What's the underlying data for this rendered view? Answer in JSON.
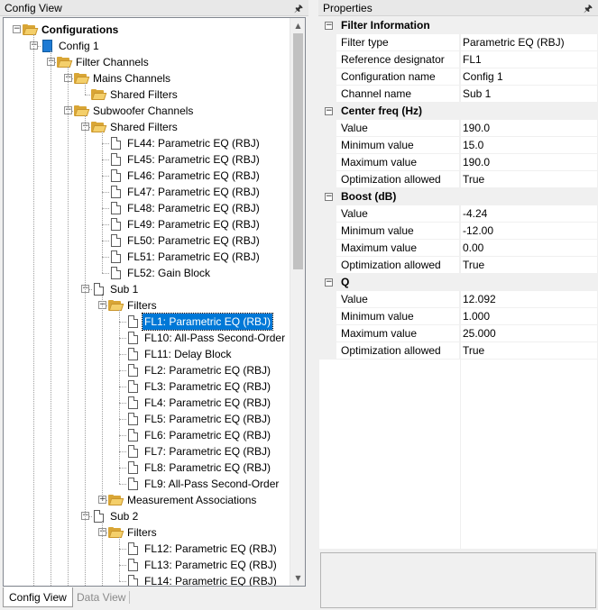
{
  "config_view": {
    "title": "Config View",
    "pin_icon": "pin-icon",
    "tree": [
      {
        "label": "Configurations",
        "icon": "folder-icon",
        "level": 0,
        "expander": "−",
        "bold": true
      },
      {
        "label": "Config 1",
        "icon": "config-icon",
        "level": 1,
        "expander": "−"
      },
      {
        "label": "Filter Channels",
        "icon": "folder-icon",
        "level": 2,
        "expander": "−"
      },
      {
        "label": "Mains Channels",
        "icon": "folder-icon",
        "level": 3,
        "expander": "−"
      },
      {
        "label": "Shared Filters",
        "icon": "folder-icon",
        "level": 4,
        "expander": ""
      },
      {
        "label": "Subwoofer Channels",
        "icon": "folder-icon",
        "level": 3,
        "expander": "−"
      },
      {
        "label": "Shared Filters",
        "icon": "folder-icon",
        "level": 4,
        "expander": "−"
      },
      {
        "label": "FL44: Parametric EQ (RBJ)",
        "icon": "document-icon",
        "level": 5,
        "expander": ""
      },
      {
        "label": "FL45: Parametric EQ (RBJ)",
        "icon": "document-icon",
        "level": 5,
        "expander": ""
      },
      {
        "label": "FL46: Parametric EQ (RBJ)",
        "icon": "document-icon",
        "level": 5,
        "expander": ""
      },
      {
        "label": "FL47: Parametric EQ (RBJ)",
        "icon": "document-icon",
        "level": 5,
        "expander": ""
      },
      {
        "label": "FL48: Parametric EQ (RBJ)",
        "icon": "document-icon",
        "level": 5,
        "expander": ""
      },
      {
        "label": "FL49: Parametric EQ (RBJ)",
        "icon": "document-icon",
        "level": 5,
        "expander": ""
      },
      {
        "label": "FL50: Parametric EQ (RBJ)",
        "icon": "document-icon",
        "level": 5,
        "expander": ""
      },
      {
        "label": "FL51: Parametric EQ (RBJ)",
        "icon": "document-icon",
        "level": 5,
        "expander": ""
      },
      {
        "label": "FL52: Gain Block",
        "icon": "document-icon",
        "level": 5,
        "expander": ""
      },
      {
        "label": "Sub 1",
        "icon": "document-icon",
        "level": 4,
        "expander": "−"
      },
      {
        "label": "Filters",
        "icon": "folder-icon",
        "level": 5,
        "expander": "−"
      },
      {
        "label": "FL1: Parametric EQ (RBJ)",
        "icon": "document-icon",
        "level": 6,
        "expander": "",
        "selected": true
      },
      {
        "label": "FL10: All-Pass Second-Order",
        "icon": "document-icon",
        "level": 6,
        "expander": ""
      },
      {
        "label": "FL11: Delay Block",
        "icon": "document-icon",
        "level": 6,
        "expander": ""
      },
      {
        "label": "FL2: Parametric EQ (RBJ)",
        "icon": "document-icon",
        "level": 6,
        "expander": ""
      },
      {
        "label": "FL3: Parametric EQ (RBJ)",
        "icon": "document-icon",
        "level": 6,
        "expander": ""
      },
      {
        "label": "FL4: Parametric EQ (RBJ)",
        "icon": "document-icon",
        "level": 6,
        "expander": ""
      },
      {
        "label": "FL5: Parametric EQ (RBJ)",
        "icon": "document-icon",
        "level": 6,
        "expander": ""
      },
      {
        "label": "FL6: Parametric EQ (RBJ)",
        "icon": "document-icon",
        "level": 6,
        "expander": ""
      },
      {
        "label": "FL7: Parametric EQ (RBJ)",
        "icon": "document-icon",
        "level": 6,
        "expander": ""
      },
      {
        "label": "FL8: Parametric EQ (RBJ)",
        "icon": "document-icon",
        "level": 6,
        "expander": ""
      },
      {
        "label": "FL9: All-Pass Second-Order",
        "icon": "document-icon",
        "level": 6,
        "expander": ""
      },
      {
        "label": "Measurement Associations",
        "icon": "folder-icon",
        "level": 5,
        "expander": "+"
      },
      {
        "label": "Sub 2",
        "icon": "document-icon",
        "level": 4,
        "expander": "−"
      },
      {
        "label": "Filters",
        "icon": "folder-icon",
        "level": 5,
        "expander": "−"
      },
      {
        "label": "FL12: Parametric EQ (RBJ)",
        "icon": "document-icon",
        "level": 6,
        "expander": ""
      },
      {
        "label": "FL13: Parametric EQ (RBJ)",
        "icon": "document-icon",
        "level": 6,
        "expander": ""
      },
      {
        "label": "FL14: Parametric EQ (RBJ)",
        "icon": "document-icon",
        "level": 6,
        "expander": ""
      }
    ],
    "tabs": [
      {
        "label": "Config View",
        "active": true
      },
      {
        "label": "Data View",
        "active": false
      }
    ]
  },
  "properties": {
    "title": "Properties",
    "categories": [
      {
        "name": "Filter Information",
        "rows": [
          {
            "name": "Filter type",
            "value": "Parametric EQ (RBJ)"
          },
          {
            "name": "Reference designator",
            "value": "FL1"
          },
          {
            "name": "Configuration name",
            "value": "Config 1"
          },
          {
            "name": "Channel name",
            "value": "Sub 1"
          }
        ]
      },
      {
        "name": "Center freq (Hz)",
        "rows": [
          {
            "name": "Value",
            "value": "190.0"
          },
          {
            "name": "Minimum value",
            "value": "15.0"
          },
          {
            "name": "Maximum value",
            "value": "190.0"
          },
          {
            "name": "Optimization allowed",
            "value": "True"
          }
        ]
      },
      {
        "name": "Boost (dB)",
        "rows": [
          {
            "name": "Value",
            "value": "-4.24"
          },
          {
            "name": "Minimum value",
            "value": "-12.00"
          },
          {
            "name": "Maximum value",
            "value": "0.00"
          },
          {
            "name": "Optimization allowed",
            "value": "True"
          }
        ]
      },
      {
        "name": "Q",
        "rows": [
          {
            "name": "Value",
            "value": "12.092"
          },
          {
            "name": "Minimum value",
            "value": "1.000"
          },
          {
            "name": "Maximum value",
            "value": "25.000"
          },
          {
            "name": "Optimization allowed",
            "value": "True"
          }
        ]
      }
    ],
    "collapse_symbol": "−"
  },
  "colors": {
    "selection": "#0078d7",
    "folder": "#f4cf6a",
    "config_icon": "#1e7bd4",
    "panel_bg": "#f0f0f0"
  }
}
